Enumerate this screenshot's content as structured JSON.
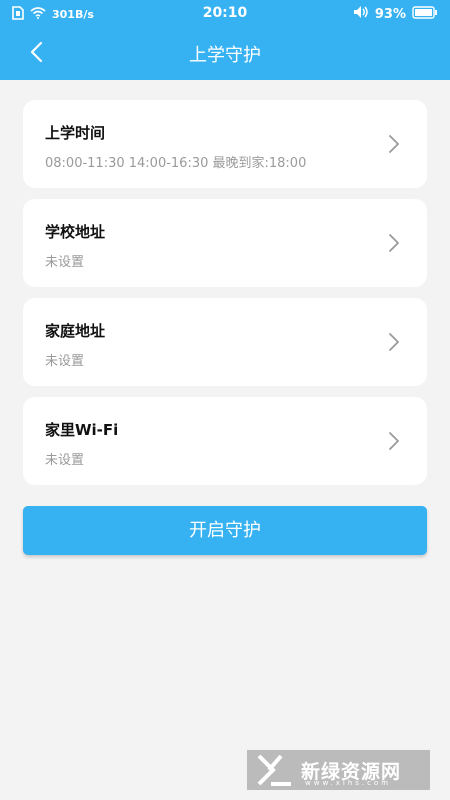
{
  "status_bar": {
    "net_speed": "301B/s",
    "time": "20:10",
    "battery": "93%"
  },
  "nav": {
    "title": "上学守护"
  },
  "items": [
    {
      "title": "上学时间",
      "subtitle": "08:00-11:30 14:00-16:30 最晚到家:18:00"
    },
    {
      "title": "学校地址",
      "subtitle": "未设置"
    },
    {
      "title": "家庭地址",
      "subtitle": "未设置"
    },
    {
      "title": "家里Wi-Fi",
      "subtitle": "未设置"
    }
  ],
  "action": {
    "start_label": "开启守护"
  },
  "watermark": {
    "brand": "新绿资源网",
    "url": "www.xlhs.com"
  },
  "icons": [
    "sim-icon",
    "wifi-icon",
    "speaker-icon",
    "battery-icon",
    "back-arrow-icon",
    "chevron-right-icon"
  ],
  "colors": {
    "accent": "#36b2f3",
    "background": "#f3f3f3",
    "card": "#ffffff",
    "subtitle": "#9a9a9a"
  }
}
